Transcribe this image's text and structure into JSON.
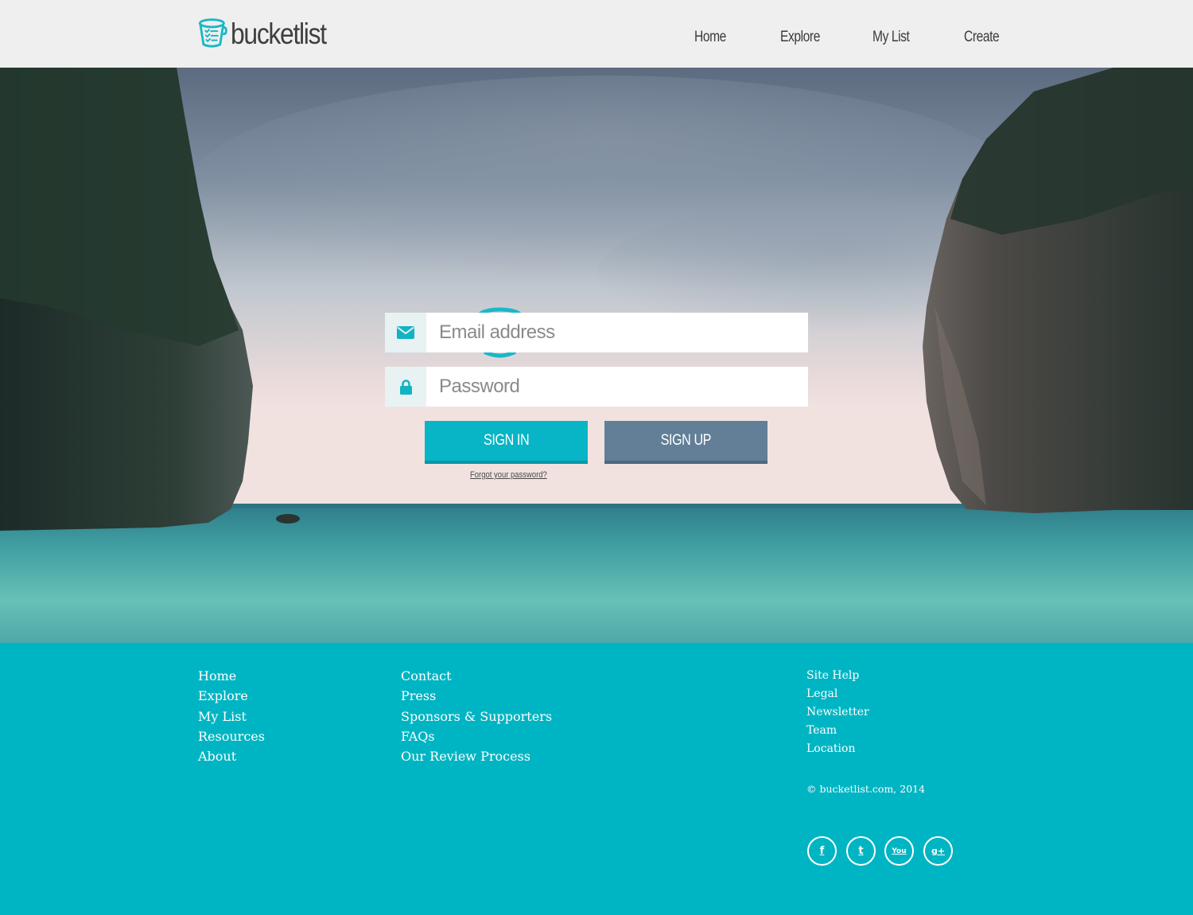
{
  "header": {
    "brand": "bucketlist",
    "nav": [
      {
        "label": "Home"
      },
      {
        "label": "Explore"
      },
      {
        "label": "My List"
      },
      {
        "label": "Create"
      }
    ]
  },
  "hero": {
    "logo_text": "bucketlist",
    "email": {
      "placeholder": "Email address",
      "icon": "envelope-icon"
    },
    "password": {
      "placeholder": "Password",
      "icon": "lock-icon"
    },
    "signin_label": "SIGN IN",
    "signup_label": "SIGN UP",
    "forgot_label": "Forgot your password?"
  },
  "footer": {
    "col1": [
      "Home",
      "Explore",
      "My List",
      "Resources",
      "About"
    ],
    "col2": [
      "Contact",
      "Press",
      "Sponsors & Supporters",
      "FAQs",
      "Our Review Process"
    ],
    "col3": [
      "Site Help",
      "Legal",
      "Newsletter",
      "Team",
      "Location"
    ],
    "copyright": "© bucketlist.com, 2014",
    "social": [
      {
        "icon": "facebook-icon",
        "glyph": "f"
      },
      {
        "icon": "twitter-icon",
        "glyph": "t"
      },
      {
        "icon": "youtube-icon",
        "glyph": "You"
      },
      {
        "icon": "google-plus-icon",
        "glyph": "g+"
      }
    ]
  },
  "colors": {
    "accent": "#00b5c3",
    "signin": "#08b5c6",
    "signup": "#627f97",
    "header_bg": "#efefef",
    "logo_text": "#333333"
  }
}
